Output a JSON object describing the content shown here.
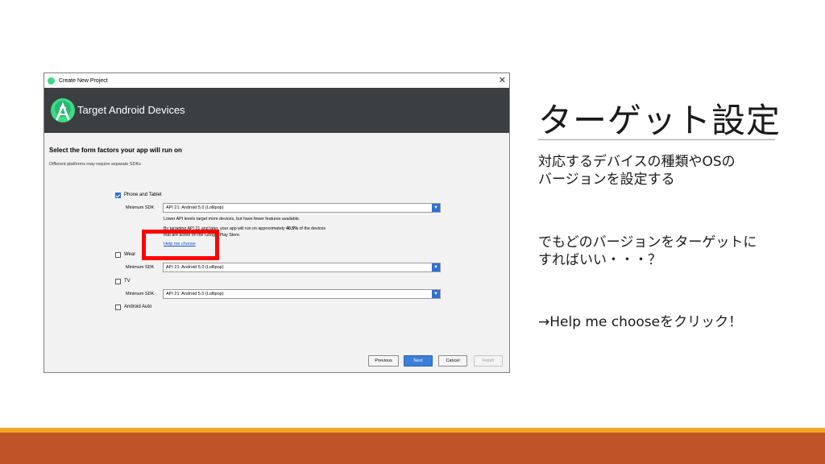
{
  "window": {
    "title": "Create New Project",
    "header_title": "Target Android Devices",
    "heading": "Select the form factors your app will run on",
    "subheading": "Different platforms may require separate SDKs",
    "form_factors": [
      {
        "label": "Phone and Tablet",
        "checked": true,
        "sdk_label": "Minimum SDK",
        "sdk_value": "API 21: Android 5.0 (Lollipop)"
      },
      {
        "label": "Wear",
        "checked": false,
        "sdk_label": "Minimum SDK",
        "sdk_value": "API 21: Android 5.0 (Lollipop)"
      },
      {
        "label": "TV",
        "checked": false,
        "sdk_label": "Minimum SDK",
        "sdk_value": "API 21: Android 5.0 (Lollipop)"
      },
      {
        "label": "Android Auto",
        "checked": false
      }
    ],
    "info_line1": "Lower API levels target more devices, but have fewer features available.",
    "info_line2_prefix": "By targeting API 21 and later, your app will run on approximately ",
    "info_line2_bold": "40.5%",
    "info_line2_suffix": " of the devices",
    "info_line3": "that are active on the Google Play Store.",
    "help_link": "Help me choose",
    "buttons": {
      "previous": "Previous",
      "next": "Next",
      "cancel": "Cancel",
      "finish": "Finish"
    },
    "close_glyph": "✕"
  },
  "slide": {
    "title": "ターゲット設定",
    "line1": "対応するデバイスの種類やOSの",
    "line2": "バージョンを設定する",
    "line3": "でもどのバージョンをターゲットに",
    "line4": "すればいい・・・？",
    "line5": "→Help me chooseをクリック！"
  },
  "icons": {
    "android_studio": "android-studio-logo-icon",
    "close": "close-icon",
    "dropdown": "chevron-down-icon"
  },
  "colors": {
    "header_bg": "#3c3f41",
    "accent_blue": "#2d6fd6",
    "highlight": "#ff0000",
    "bar_orange": "#f0a92a",
    "bar_rust": "#bf5428"
  }
}
